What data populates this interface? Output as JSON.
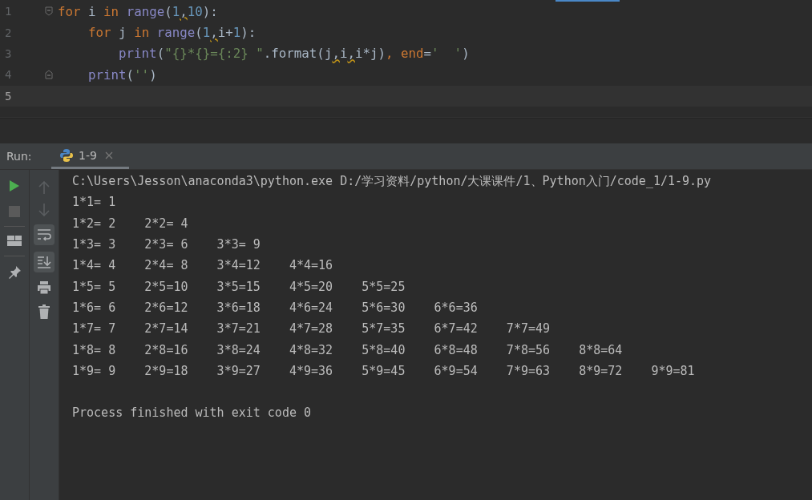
{
  "editor": {
    "lines": [
      {
        "number": "1",
        "current": false,
        "fold_start": true,
        "fold_end": false,
        "tokens": [
          {
            "kind": "kw",
            "text": "for"
          },
          {
            "kind": "plain",
            "text": " i "
          },
          {
            "kind": "kw",
            "text": "in "
          },
          {
            "kind": "fn",
            "text": "range"
          },
          {
            "kind": "plain",
            "text": "("
          },
          {
            "kind": "num",
            "text": "1"
          },
          {
            "kind": "warn",
            "text": ","
          },
          {
            "kind": "num",
            "text": "10"
          },
          {
            "kind": "plain",
            "text": "):"
          }
        ],
        "children": [
          {
            "number": "2",
            "current": false,
            "fold_start": false,
            "fold_end": false,
            "tokens": [
              {
                "kind": "kw",
                "text": "for"
              },
              {
                "kind": "plain",
                "text": " j "
              },
              {
                "kind": "kw",
                "text": "in "
              },
              {
                "kind": "fn",
                "text": "range"
              },
              {
                "kind": "plain",
                "text": "("
              },
              {
                "kind": "num",
                "text": "1"
              },
              {
                "kind": "warn",
                "text": ","
              },
              {
                "kind": "plain",
                "text": "i+"
              },
              {
                "kind": "num",
                "text": "1"
              },
              {
                "kind": "plain",
                "text": "):"
              }
            ],
            "children": [
              {
                "number": "3",
                "current": false,
                "fold_start": false,
                "fold_end": false,
                "tokens": [
                  {
                    "kind": "fn",
                    "text": "print"
                  },
                  {
                    "kind": "plain",
                    "text": "("
                  },
                  {
                    "kind": "str",
                    "text": "\"{}*{}={:2} \""
                  },
                  {
                    "kind": "plain",
                    "text": ".format(j"
                  },
                  {
                    "kind": "warn",
                    "text": ","
                  },
                  {
                    "kind": "plain",
                    "text": "i"
                  },
                  {
                    "kind": "warn",
                    "text": ","
                  },
                  {
                    "kind": "plain",
                    "text": "i*j)"
                  },
                  {
                    "kind": "param",
                    "text": ", end"
                  },
                  {
                    "kind": "plain",
                    "text": "="
                  },
                  {
                    "kind": "str",
                    "text": "'  '"
                  },
                  {
                    "kind": "plain",
                    "text": ")"
                  }
                ]
              }
            ]
          },
          {
            "number": "4",
            "current": false,
            "fold_start": false,
            "fold_end": true,
            "tokens": [
              {
                "kind": "fn",
                "text": "print"
              },
              {
                "kind": "plain",
                "text": "("
              },
              {
                "kind": "str",
                "text": "''"
              },
              {
                "kind": "plain",
                "text": ")"
              }
            ]
          }
        ]
      },
      {
        "number": "5",
        "current": true,
        "fold_start": false,
        "fold_end": false
      }
    ]
  },
  "run": {
    "label": "Run:",
    "tab": {
      "label": "1-9",
      "selected": true
    },
    "output": [
      "C:\\Users\\Jesson\\anaconda3\\python.exe D:/学习资料/python/大课课件/1、Python入门/code_1/1-9.py",
      "1*1= 1",
      "1*2= 2    2*2= 4",
      "1*3= 3    2*3= 6    3*3= 9",
      "1*4= 4    2*4= 8    3*4=12    4*4=16",
      "1*5= 5    2*5=10    3*5=15    4*5=20    5*5=25",
      "1*6= 6    2*6=12    3*6=18    4*6=24    5*6=30    6*6=36",
      "1*7= 7    2*7=14    3*7=21    4*7=28    5*7=35    6*7=42    7*7=49",
      "1*8= 8    2*8=16    3*8=24    4*8=32    5*8=40    6*8=48    7*8=56    8*8=64",
      "1*9= 9    2*9=18    3*9=27    4*9=36    5*9=45    6*9=54    7*9=63    8*9=72    9*9=81"
    ],
    "status": "Process finished with exit code 0"
  }
}
